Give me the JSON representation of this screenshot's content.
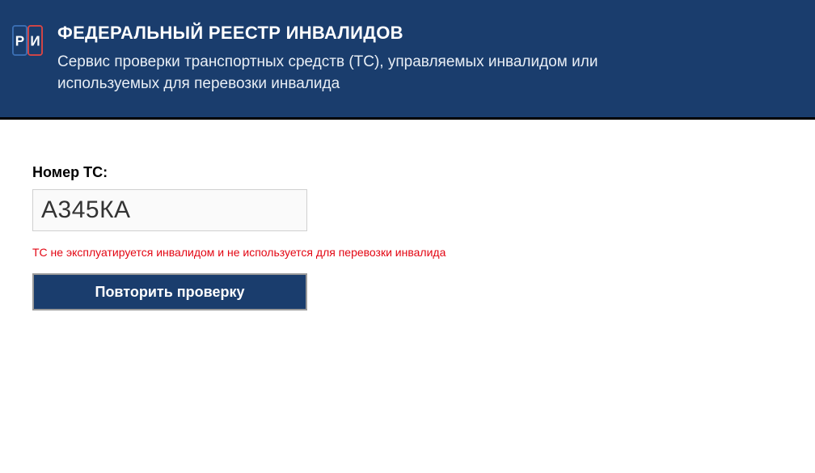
{
  "header": {
    "title": "ФЕДЕРАЛЬНЫЙ РЕЕСТР ИНВАЛИДОВ",
    "subtitle": "Сервис проверки транспортных средств (ТС), управляемых инвалидом или используемых для перевозки инвалида"
  },
  "form": {
    "label": "Номер ТС:",
    "input_value": "А345КА",
    "error_message": "ТС не эксплуатируется инвалидом и не используется для перевозки инвалида",
    "button_label": "Повторить проверку"
  }
}
